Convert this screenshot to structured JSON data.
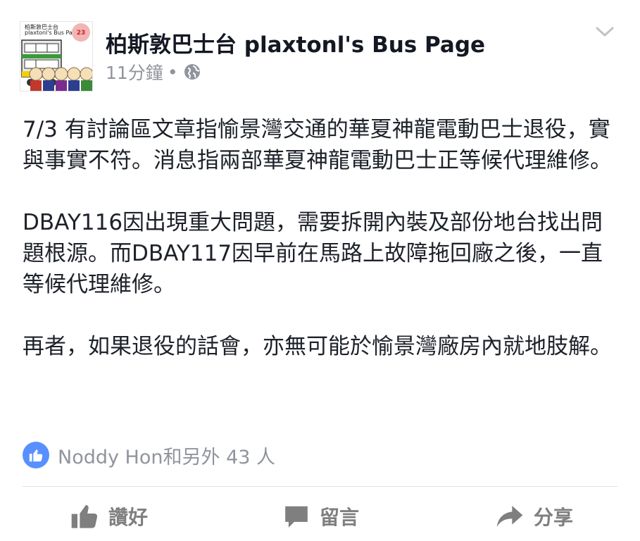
{
  "post": {
    "page_name": "柏斯敦巴士台 plaxtonl's Bus Page",
    "time": "11分鐘",
    "separator": "•",
    "avatar": {
      "title": "柏斯敦巴士台",
      "subtitle": "plaxtonl's Bus Page",
      "badge": "23"
    },
    "paragraphs": [
      "7/3 有討論區文章指愉景灣交通的華夏神龍電動巴士退役，實與事實不符。消息指兩部華夏神龍電動巴士正等候代理維修。",
      "DBAY116因出現重大問題，需要拆開內裝及部份地台找出問題根源。而DBAY117因早前在馬路上故障拖回廠之後，一直等候代理維修。",
      "再者，如果退役的話會，亦無可能於愉景灣廠房內就地肢解。"
    ],
    "likes_text": "Noddy Hon和另外 43 人"
  },
  "actions": {
    "like_label": "讚好",
    "comment_label": "留言",
    "share_label": "分享"
  },
  "colors": {
    "accent": "#5890ff",
    "secondary_text": "#90949c",
    "action_gray": "#7f7f7f"
  }
}
